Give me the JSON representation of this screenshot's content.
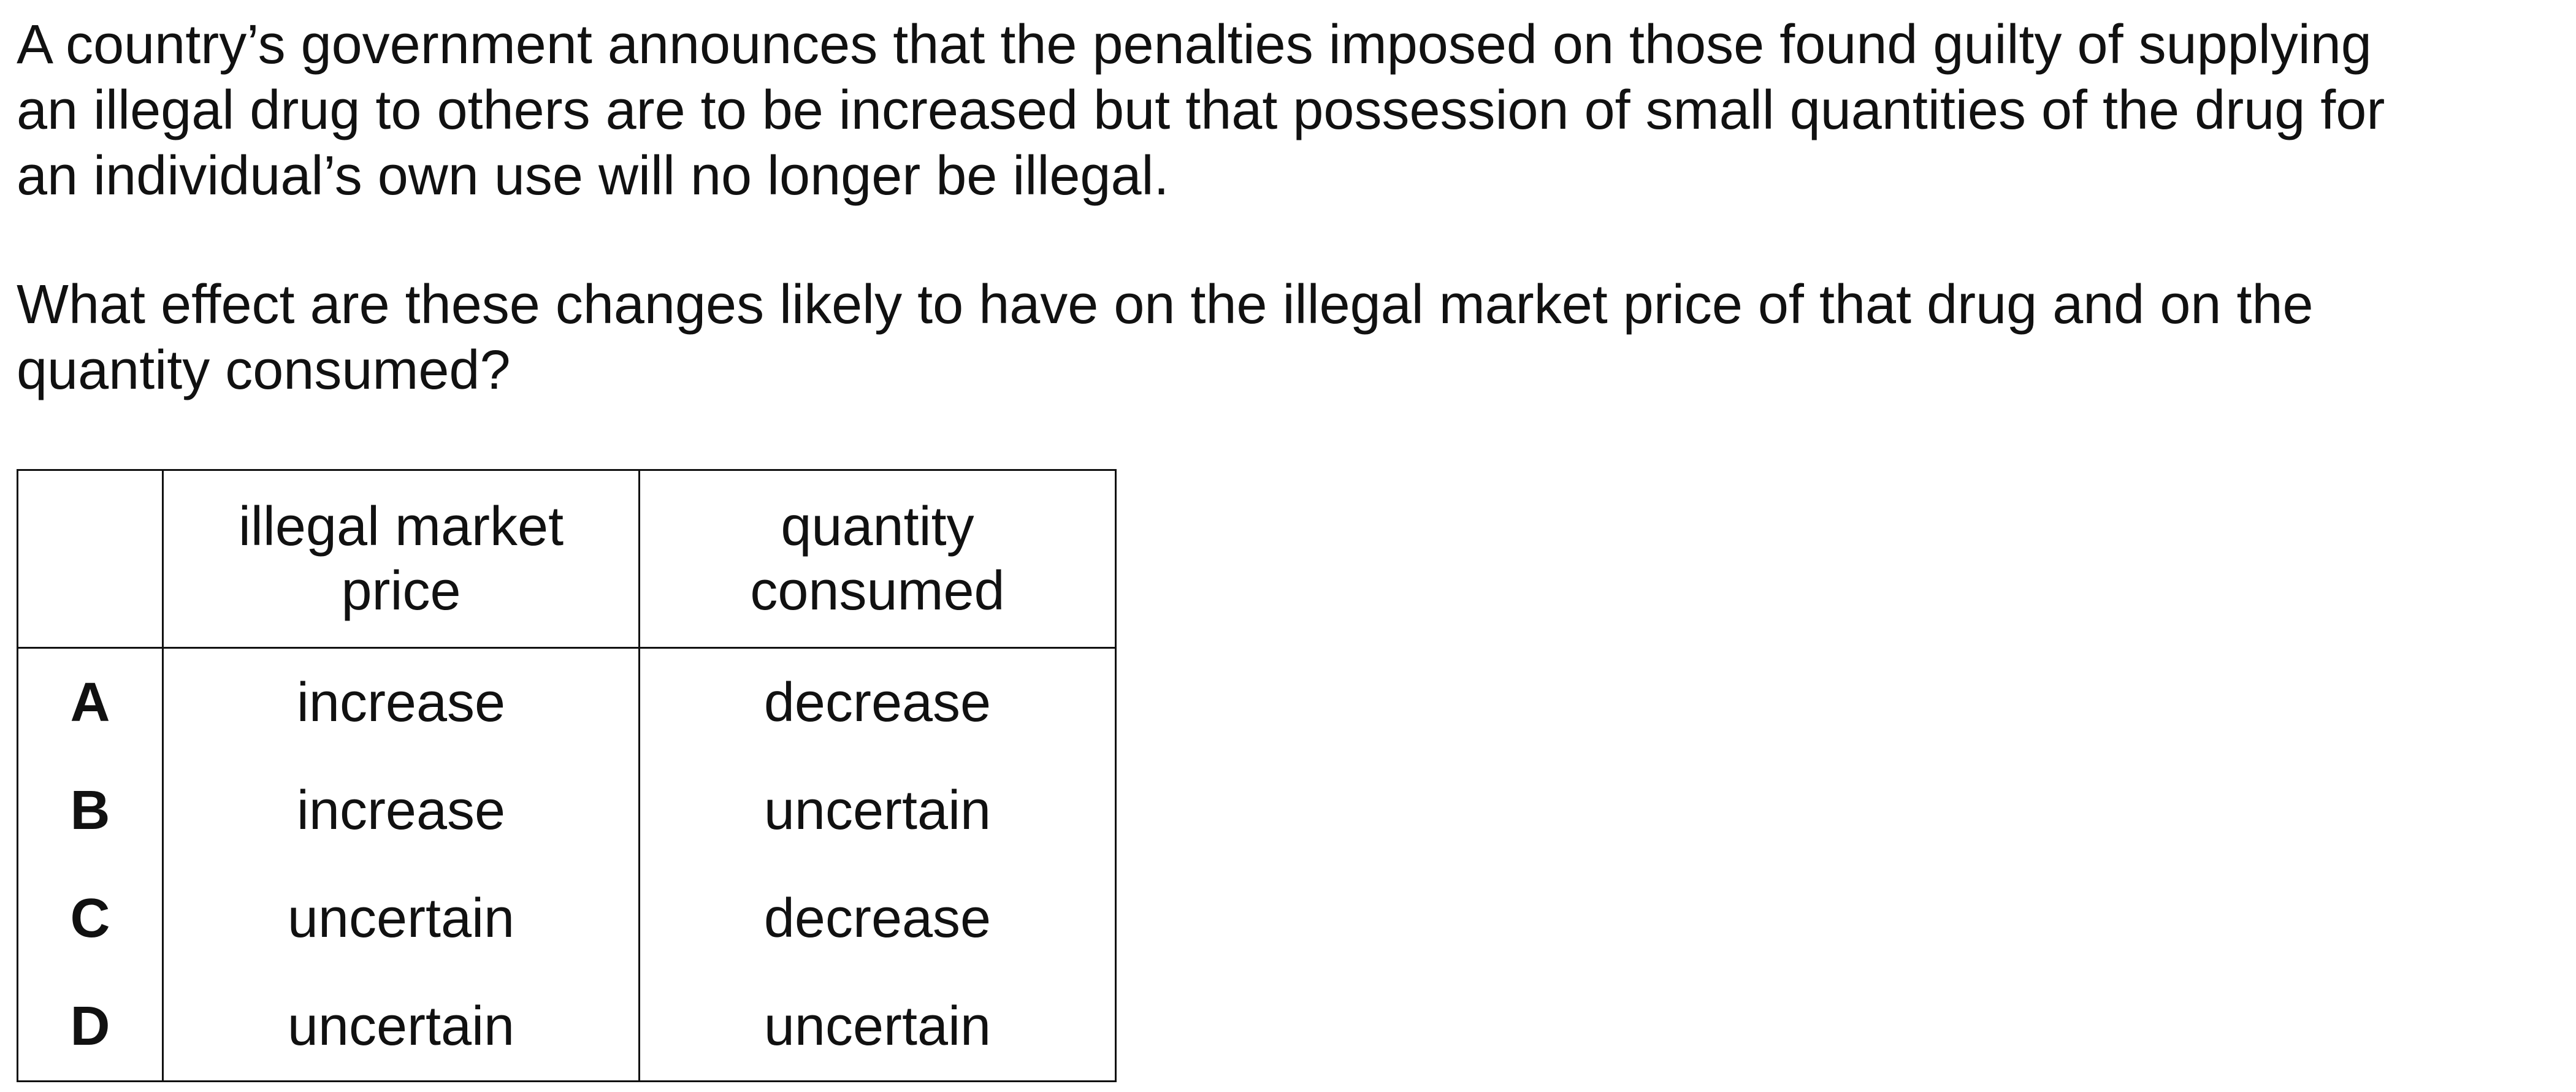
{
  "question": {
    "stem_lines": [
      "A country’s government announces that the penalties imposed on those found guilty of supplying",
      "an illegal drug to others are to be increased but that possession of small quantities of the drug for",
      "an individual’s own use will no longer be illegal."
    ],
    "prompt_lines": [
      "What effect are these changes likely to have on the illegal market price of that drug and on the",
      "quantity consumed?"
    ]
  },
  "table": {
    "headers": {
      "price_line1": "illegal market",
      "price_line2": "price",
      "qty_line1": "quantity",
      "qty_line2": "consumed"
    },
    "rows": [
      {
        "key": "A",
        "price": "increase",
        "quantity": "decrease"
      },
      {
        "key": "B",
        "price": "increase",
        "quantity": "uncertain"
      },
      {
        "key": "C",
        "price": "uncertain",
        "quantity": "decrease"
      },
      {
        "key": "D",
        "price": "uncertain",
        "quantity": "uncertain"
      }
    ]
  }
}
